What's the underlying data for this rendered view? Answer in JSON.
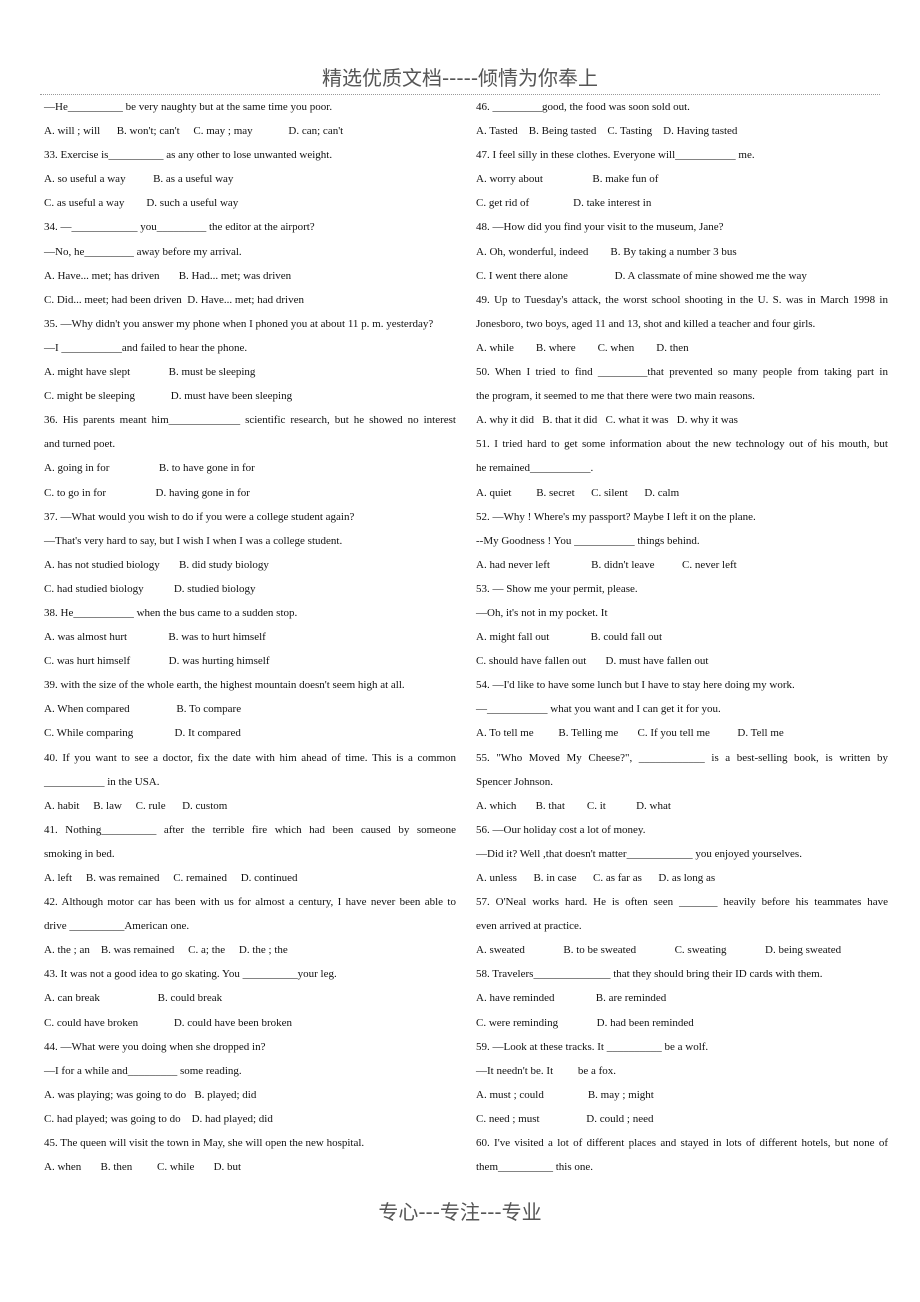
{
  "header": {
    "title": "精选优质文档-----倾情为你奉上"
  },
  "footer": {
    "text": "专心---专注---专业"
  },
  "left_column": [
    {
      "t": "—He__________ be very naughty but at the same time you poor."
    },
    {
      "t": "A. will ; will      B. won't; can't     C. may ; may             D. can; can't"
    },
    {
      "t": "33. Exercise is__________ as any other to lose unwanted weight."
    },
    {
      "t": "A. so useful a way          B. as a useful way"
    },
    {
      "t": "C. as useful a way        D. such a useful way"
    },
    {
      "t": "34. —____________ you_________ the editor at the airport?"
    },
    {
      "t": "—No, he_________ away before my arrival."
    },
    {
      "t": "A. Have... met; has driven       B. Had... met; was driven"
    },
    {
      "t": "C. Did... meet; had been driven  D. Have... met; had driven"
    },
    {
      "t": "35. —Why didn't you answer my phone when I phoned you at about 11 p. m. yesterday?"
    },
    {
      "t": "—I ___________and failed to hear the phone."
    },
    {
      "t": "A. might have slept              B. must be sleeping"
    },
    {
      "t": "C. might be sleeping             D. must have been sleeping"
    },
    {
      "t": "36. His parents meant him_____________ scientific research, but he showed no interest",
      "j": true
    },
    {
      "t": "and turned poet."
    },
    {
      "t": "A. going in for                  B. to have gone in for"
    },
    {
      "t": "C. to go in for                  D. having gone in for"
    },
    {
      "t": "37. —What would you wish to do if you were a college student again?"
    },
    {
      "t": "—That's very hard to say, but I wish I when I was a college student."
    },
    {
      "t": "A. has not studied biology       B. did study biology"
    },
    {
      "t": "C. had studied biology           D. studied biology"
    },
    {
      "t": "38. He___________ when the bus came to a sudden stop."
    },
    {
      "t": "A. was almost hurt               B. was to hurt himself"
    },
    {
      "t": "C. was hurt himself              D. was hurting himself"
    },
    {
      "t": "39. with the size of the whole earth, the highest mountain doesn't seem high at all."
    },
    {
      "t": "A. When compared                 B. To compare"
    },
    {
      "t": "C. While comparing               D. It compared"
    },
    {
      "t": "40. If you want to see a doctor, fix the date with him ahead of time. This is a common",
      "j": true
    },
    {
      "t": "___________ in the USA."
    },
    {
      "t": "A. habit     B. law     C. rule      D. custom"
    },
    {
      "t": "41. Nothing__________ after the terrible fire which had been caused by someone",
      "j": true
    },
    {
      "t": "smoking in bed."
    },
    {
      "t": "A. left     B. was remained     C. remained     D. continued"
    },
    {
      "t": "42. Although motor car has been with us for almost a century, I have never been able to",
      "j": true
    },
    {
      "t": "drive __________American one."
    },
    {
      "t": "A. the ; an    B. was remained     C. a; the     D. the ; the"
    },
    {
      "t": "43. It was not a good idea to go skating. You __________your leg."
    },
    {
      "t": "A. can break                     B. could break"
    },
    {
      "t": "C. could have broken             D. could have been broken"
    },
    {
      "t": "44. —What were you doing when she dropped in?"
    },
    {
      "t": "—I for a while and_________ some reading."
    },
    {
      "t": "A. was playing; was going to do   B. played; did"
    },
    {
      "t": "C. had played; was going to do    D. had played; did"
    },
    {
      "t": "45. The queen will visit the town in May, she will open the new hospital."
    },
    {
      "t": "A. when       B. then         C. while       D. but"
    }
  ],
  "right_column": [
    {
      "t": "46. _________good, the food was soon sold out."
    },
    {
      "t": "A. Tasted    B. Being tasted    C. Tasting    D. Having tasted"
    },
    {
      "t": "47. I feel silly in these clothes. Everyone will___________ me."
    },
    {
      "t": "A. worry about                  B. make fun of"
    },
    {
      "t": "C. get rid of                D. take interest in"
    },
    {
      "t": "48. —How did you find your visit to the museum, Jane?"
    },
    {
      "t": "A. Oh, wonderful, indeed        B. By taking a number 3 bus"
    },
    {
      "t": "C. I went there alone                 D. A classmate of mine showed me the way"
    },
    {
      "t": "49. Up to Tuesday's attack, the worst school shooting in the U. S. was in March 1998 in",
      "j": true
    },
    {
      "t": "Jonesboro, two boys, aged 11 and 13, shot and killed a teacher and four girls."
    },
    {
      "t": "A. while        B. where        C. when        D. then"
    },
    {
      "t": "50. When I tried to find _________that prevented so many people from taking part in",
      "j": true
    },
    {
      "t": "the program, it seemed to me that there were two main reasons."
    },
    {
      "t": "A. why it did   B. that it did   C. what it was   D. why it was"
    },
    {
      "t": "51. I tried hard to get some information about the new technology out of his mouth, but",
      "j": true
    },
    {
      "t": "he remained___________."
    },
    {
      "t": "A. quiet         B. secret      C. silent      D. calm"
    },
    {
      "t": "52. —Why ! Where's my passport? Maybe I left it on the plane."
    },
    {
      "t": "--My Goodness ! You ___________ things behind."
    },
    {
      "t": "A. had never left               B. didn't leave          C. never left"
    },
    {
      "t": "53. — Show me your permit, please."
    },
    {
      "t": "—Oh, it's not in my pocket. It"
    },
    {
      "t": "A. might fall out               B. could fall out"
    },
    {
      "t": "C. should have fallen out       D. must have fallen out"
    },
    {
      "t": "54. —I'd like to have some lunch but I have to stay here doing my work."
    },
    {
      "t": "—___________ what you want and I can get it for you."
    },
    {
      "t": "A. To tell me         B. Telling me       C. If you tell me          D. Tell me"
    },
    {
      "t": "55. \"Who Moved My Cheese?\", ____________ is a best-selling book, is written by",
      "j": true
    },
    {
      "t": "Spencer Johnson."
    },
    {
      "t": "A. which       B. that        C. it           D. what"
    },
    {
      "t": "56. —Our holiday cost a lot of money."
    },
    {
      "t": "—Did it? Well ,that doesn't matter____________ you enjoyed yourselves."
    },
    {
      "t": "A. unless      B. in case      C. as far as      D. as long as"
    },
    {
      "t": "57. O'Neal works hard. He is often seen _______ heavily before his teammates have",
      "j": true
    },
    {
      "t": "even arrived at practice."
    },
    {
      "t": "A. sweated              B. to be sweated              C. sweating              D. being sweated"
    },
    {
      "t": "58. Travelers______________ that they should bring their ID cards with them."
    },
    {
      "t": "A. have reminded               B. are reminded"
    },
    {
      "t": "C. were reminding              D. had been reminded"
    },
    {
      "t": "59. —Look at these tracks. It __________ be a wolf."
    },
    {
      "t": "—It needn't be. It         be a fox."
    },
    {
      "t": "A. must ; could                B. may ; might"
    },
    {
      "t": "C. need ; must                 D. could ; need"
    },
    {
      "t": "60. I've visited a lot of different places and stayed in lots of different hotels, but none of",
      "j": true
    },
    {
      "t": "them__________ this one."
    }
  ]
}
